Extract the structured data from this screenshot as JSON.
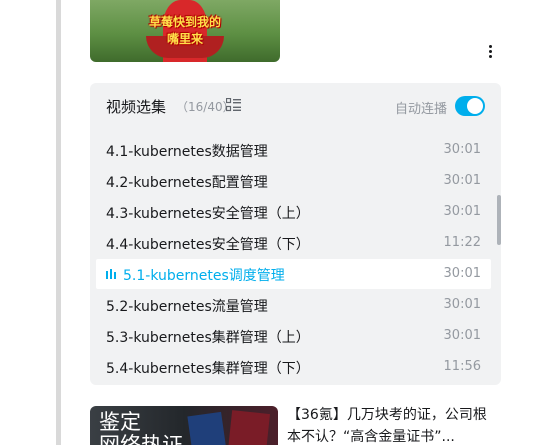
{
  "top_video": {
    "thumbnail_caption_line1": "草莓快到我的",
    "thumbnail_caption_line2": "嘴里来"
  },
  "more_button_icon": "more-vertical-icon",
  "playlist": {
    "title": "视频选集",
    "count": "（16/40）",
    "list_icon": "list-icon",
    "autoplay_label": "自动连播",
    "autoplay_on": true,
    "accent_color": "#00aeec",
    "episodes": [
      {
        "title": "4.1-kubernetes数据管理",
        "duration": "30:01",
        "active": false
      },
      {
        "title": "4.2-kubernetes配置管理",
        "duration": "30:01",
        "active": false
      },
      {
        "title": "4.3-kubernetes安全管理（上）",
        "duration": "30:01",
        "active": false
      },
      {
        "title": "4.4-kubernetes安全管理（下）",
        "duration": "11:22",
        "active": false
      },
      {
        "title": "5.1-kubernetes调度管理",
        "duration": "30:01",
        "active": true
      },
      {
        "title": "5.2-kubernetes流量管理",
        "duration": "30:01",
        "active": false
      },
      {
        "title": "5.3-kubernetes集群管理（上）",
        "duration": "30:01",
        "active": false
      },
      {
        "title": "5.4-kubernetes集群管理（下）",
        "duration": "11:56",
        "active": false
      }
    ]
  },
  "recommendation": {
    "thumbnail_text_line1": "鉴定",
    "thumbnail_text_line2": "网络热证",
    "title": "【36氪】几万块考的证，公司根本不认？“高含金量证书”..."
  }
}
